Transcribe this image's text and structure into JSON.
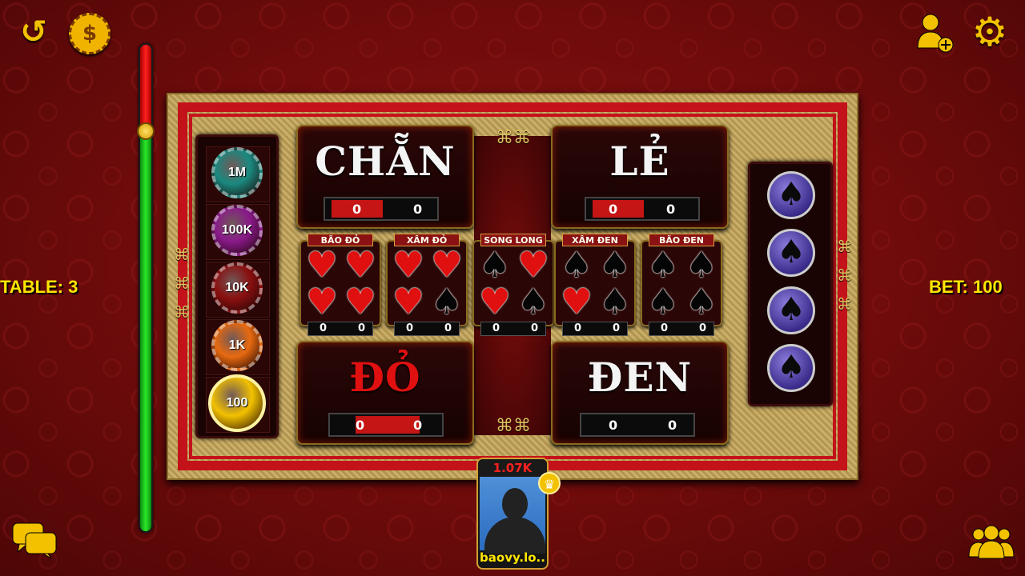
{
  "header": {
    "back_icon": "↺",
    "shop_icon": "$",
    "add_friend_icon": "add-user",
    "settings_icon": "⚙"
  },
  "table_label": "TABLE: 3",
  "bet_label": "BET: 100",
  "timer": {
    "remaining_fraction": 0.82
  },
  "chips": [
    {
      "label": "1M",
      "color": "#1a8a80"
    },
    {
      "label": "100K",
      "color": "#8a1a8a"
    },
    {
      "label": "10K",
      "color": "#8a1010"
    },
    {
      "label": "1K",
      "color": "#e86a10"
    },
    {
      "label": "100",
      "color": "#f2c100",
      "selected": true
    }
  ],
  "big_bets": {
    "chan": {
      "title": "CHẴN",
      "left": "0",
      "right": "0"
    },
    "le": {
      "title": "LẺ",
      "left": "0",
      "right": "0"
    },
    "do": {
      "title": "ĐỎ",
      "left": "0",
      "right": "0"
    },
    "den": {
      "title": "ĐEN",
      "left": "0",
      "right": "0"
    }
  },
  "small_bets": [
    {
      "label": "BÃO ĐỎ",
      "suits": [
        "heart",
        "heart",
        "heart",
        "heart"
      ],
      "left": "0",
      "right": "0"
    },
    {
      "label": "XÂM ĐỎ",
      "suits": [
        "heart",
        "heart",
        "heart",
        "spade"
      ],
      "left": "0",
      "right": "0"
    },
    {
      "label": "SONG LONG",
      "suits": [
        "spade",
        "heart",
        "heart",
        "spade"
      ],
      "left": "0",
      "right": "0"
    },
    {
      "label": "XÂM ĐEN",
      "suits": [
        "spade",
        "spade",
        "heart",
        "spade"
      ],
      "left": "0",
      "right": "0"
    },
    {
      "label": "BÃO ĐEN",
      "suits": [
        "spade",
        "spade",
        "spade",
        "spade"
      ],
      "left": "0",
      "right": "0"
    }
  ],
  "result_chips": [
    "♠",
    "♠",
    "♠",
    "♠"
  ],
  "player": {
    "balance": "1.07K",
    "name": "baovy.lo.."
  },
  "footer": {
    "chat_icon": "chat",
    "players_icon": "group"
  }
}
